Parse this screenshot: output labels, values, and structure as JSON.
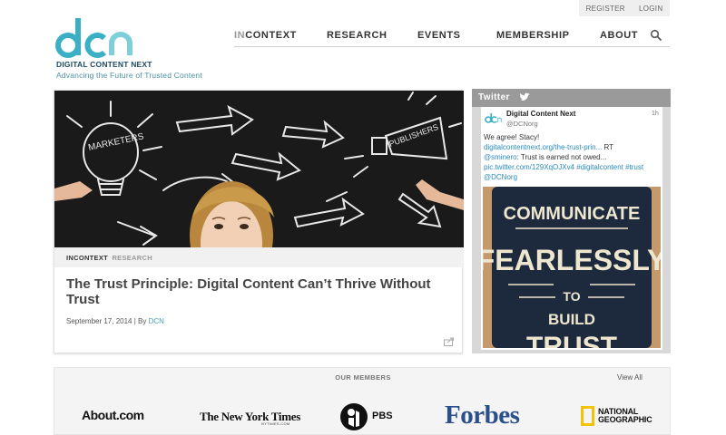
{
  "utility": {
    "register": "REGISTER",
    "login": "LOGIN"
  },
  "brand": {
    "name": "DIGITAL CONTENT NEXT",
    "tagline": "Advancing the Future of Trusted Content",
    "colors": {
      "teal": "#3bb0c4",
      "navy": "#1e4a63",
      "light_teal": "#4b8fa2"
    }
  },
  "nav": {
    "items": [
      {
        "prefix": "IN",
        "label": "CONTEXT"
      },
      {
        "label": "RESEARCH"
      },
      {
        "label": "EVENTS"
      },
      {
        "label": "MEMBERSHIP"
      },
      {
        "label": "ABOUT"
      }
    ],
    "search_icon": "search-icon"
  },
  "feature": {
    "hero_labels": {
      "left": "MARKETERS",
      "right": "PUBLISHERS"
    },
    "tag_primary": "INCONTEXT",
    "tag_secondary": "RESEARCH",
    "title": "The Trust Principle: Digital Content Can’t Thrive Without Trust",
    "date": "September 17, 2014",
    "by": " | By ",
    "author": "DCN",
    "share_icon": "share-icon"
  },
  "twitter": {
    "header": "Twitter",
    "name": "Digital Content Next",
    "handle": "@DCNorg",
    "time": "1h",
    "text_1": "We agree! Stacy!",
    "link_1": "digitalcontentnext.org/the-trust-prin...",
    "text_2": " RT",
    "mention": "@sminero",
    "text_3": ": Trust is earned not owed...",
    "link_2": "pic.twitter.com/129XqOJXv4",
    "hashtag": " #digitalcontent #trust",
    "mention_2": "@DCNorg",
    "poster": {
      "line1": "COMMUNICATE",
      "line2": "FEARLESSLY",
      "line3": "TO",
      "line4": "BUILD",
      "line5": "TRUST"
    }
  },
  "members": {
    "title": "OUR MEMBERS",
    "view_all": "View All",
    "about": "About.com",
    "nyt": "The New York Times",
    "nyt_sub": "NYTIMES.COM",
    "pbs": "PBS",
    "forbes": "Forbes",
    "ng_line1": "NATIONAL",
    "ng_line2": "GEOGRAPHIC"
  }
}
